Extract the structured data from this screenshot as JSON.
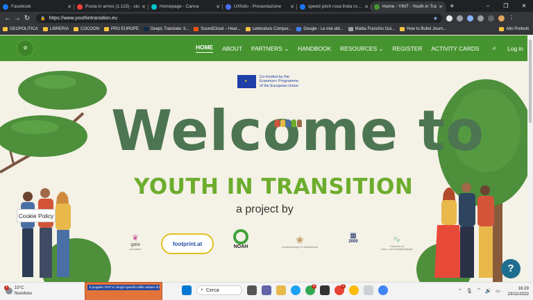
{
  "browser": {
    "tabs": [
      {
        "title": "Facebook",
        "color": "#1877f2",
        "active": false
      },
      {
        "title": "Posta in arrivo (1.115) - stu",
        "color": "#ea4335",
        "active": false
      },
      {
        "title": "Homepage - Canva",
        "color": "#00c4cc",
        "active": false
      },
      {
        "title": "UXfolio - Presentazione",
        "color": "#4c6ef5",
        "active": false
      },
      {
        "title": "speed pitch rosa linda roma",
        "color": "#1877f2",
        "active": false
      },
      {
        "title": "Home - YINT - Youth in Tra",
        "color": "#46942f",
        "active": true
      }
    ],
    "new_tab": "+",
    "url": "https://www.youthintransition.eu",
    "bookmarks": [
      {
        "label": "GEOPOLITICA",
        "color": "#f6c343"
      },
      {
        "label": "LIBRERIA",
        "color": "#f6c343"
      },
      {
        "label": "COCOON",
        "color": "#f6c343"
      },
      {
        "label": "PRO EUROPE",
        "color": "#f6c343"
      },
      {
        "label": "DeepL Translate: Il...",
        "color": "#0f2b46"
      },
      {
        "label": "SoundCloud – Hear...",
        "color": "#ff5500"
      },
      {
        "label": "Letterature Compar...",
        "color": "#f6c343"
      },
      {
        "label": "Google - Le mie atti...",
        "color": "#4285f4"
      },
      {
        "label": "Mattia Franchio Gui...",
        "color": "#9aa0a6"
      },
      {
        "label": "How to Bullet Journ...",
        "color": "#f6c343"
      }
    ],
    "other_bookmarks": "Altri Preferiti"
  },
  "site": {
    "nav": [
      {
        "label": "HOME",
        "active": true
      },
      {
        "label": "ABOUT",
        "active": false
      },
      {
        "label": "PARTNERS ⌄",
        "active": false
      },
      {
        "label": "HANDBOOK",
        "active": false
      },
      {
        "label": "RESOURCES ⌄",
        "active": false
      },
      {
        "label": "REGISTER",
        "active": false
      },
      {
        "label": "ACTIVITY CARDS",
        "active": false
      }
    ],
    "login": "Log in",
    "brand_color": "#46942f"
  },
  "hero": {
    "eu_text": [
      "Co-funded by the",
      "Erasmus+ Programme",
      "of the European Union"
    ],
    "welcome": "Welcome to",
    "subtitle": "YOUTH IN TRANSITION",
    "project_by": "a project by",
    "partners": [
      {
        "name": "gaia",
        "sub": "education"
      },
      {
        "name": "footprint.at",
        "sub": ""
      },
      {
        "name": "NOAH",
        "sub": ""
      },
      {
        "name": "Landsforeningen for Økosamfund",
        "sub": ""
      },
      {
        "name": "2000",
        "sub": ""
      },
      {
        "name": "Netzwerk für",
        "sub": "Natur- und Umweltpädagogik"
      }
    ]
  },
  "cookie": "Cookie Policy",
  "help": "?",
  "taskbar": {
    "weather_temp": "10°C",
    "weather_desc": "Nuvoloso",
    "weather_badge": "1",
    "preview_title": "Il progetto YINT e i luoghi specifici delle visitare di Irelanda",
    "search": "Cerca",
    "badges": {
      "chrome": "8",
      "mail": "2"
    },
    "time": "16:29",
    "date": "23/11/2022"
  }
}
